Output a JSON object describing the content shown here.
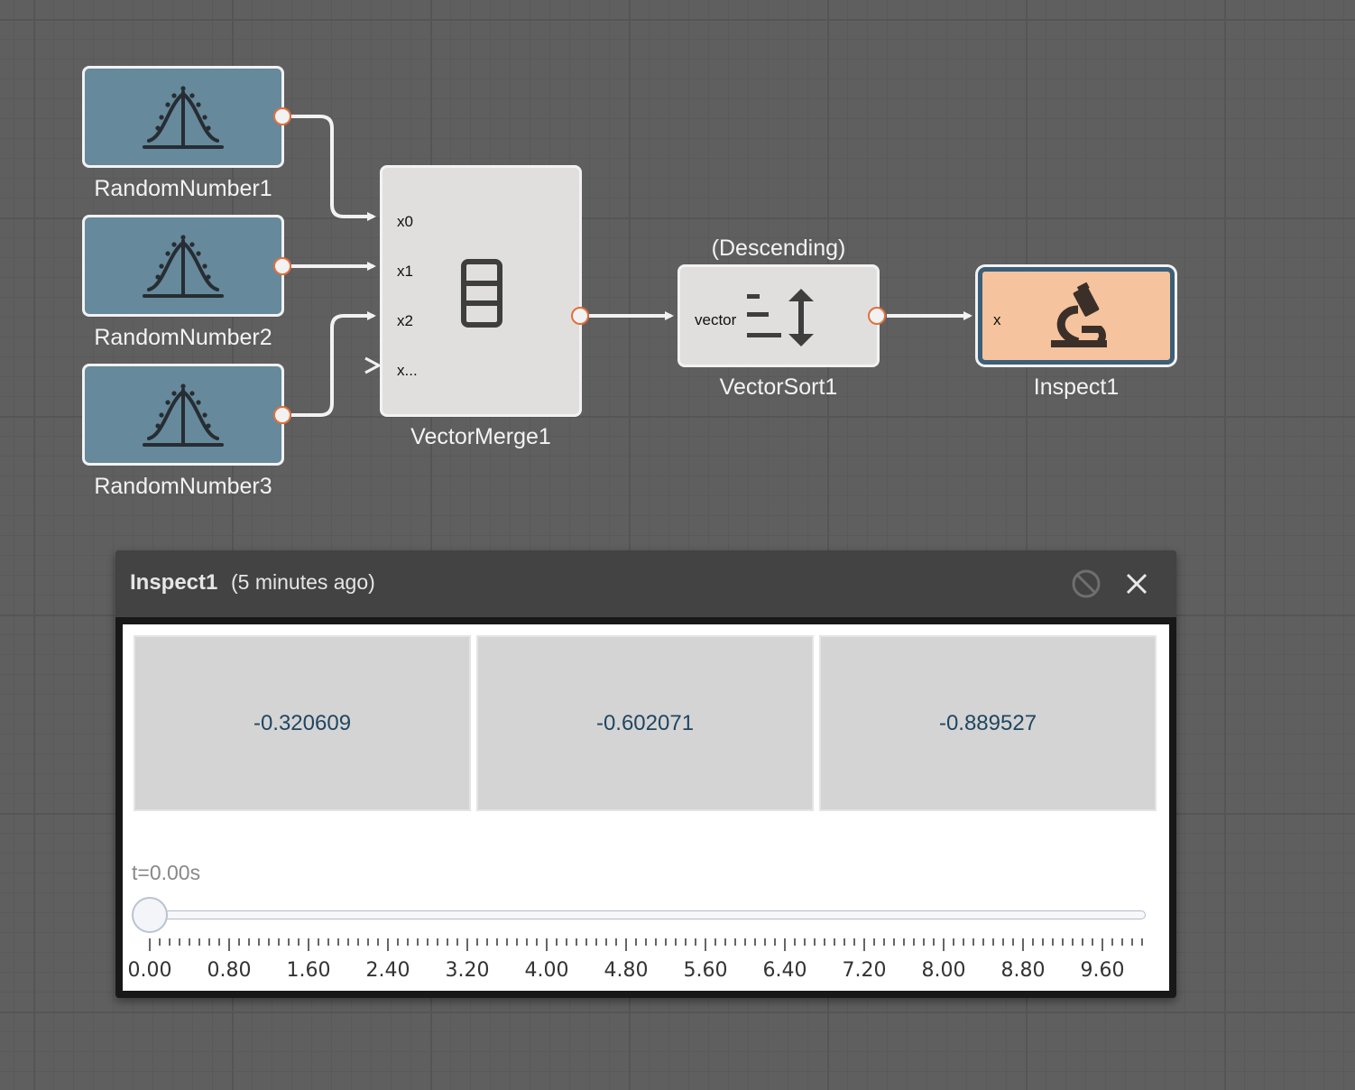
{
  "nodes": {
    "random1": {
      "label": "RandomNumber1",
      "icon": "bell-curve-icon"
    },
    "random2": {
      "label": "RandomNumber2",
      "icon": "bell-curve-icon"
    },
    "random3": {
      "label": "RandomNumber3",
      "icon": "bell-curve-icon"
    },
    "merge": {
      "label": "VectorMerge1",
      "icon": "stacked-rows-icon",
      "inputs": [
        "x0",
        "x1",
        "x2",
        "x..."
      ]
    },
    "sort": {
      "label": "VectorSort1",
      "caption": "(Descending)",
      "icon": "sort-icon",
      "input": "vector"
    },
    "inspect": {
      "label": "Inspect1",
      "icon": "microscope-icon",
      "input": "x"
    }
  },
  "panel": {
    "title": "Inspect1",
    "time": "(5 minutes ago)",
    "values": [
      "-0.320609",
      "-0.602071",
      "-0.889527"
    ],
    "time_label": "t=0.00s",
    "slider": {
      "min": 0,
      "max": 10,
      "value": 0
    },
    "tick_labels": [
      "0.00",
      "0.80",
      "1.60",
      "2.40",
      "3.20",
      "4.00",
      "4.80",
      "5.60",
      "6.40",
      "7.20",
      "8.00",
      "8.80",
      "9.60"
    ]
  },
  "colors": {
    "random_node": "#66899b",
    "inspect_node": "#f5c39d",
    "port_outline": "#e0703e",
    "value_text": "#1f4661"
  }
}
